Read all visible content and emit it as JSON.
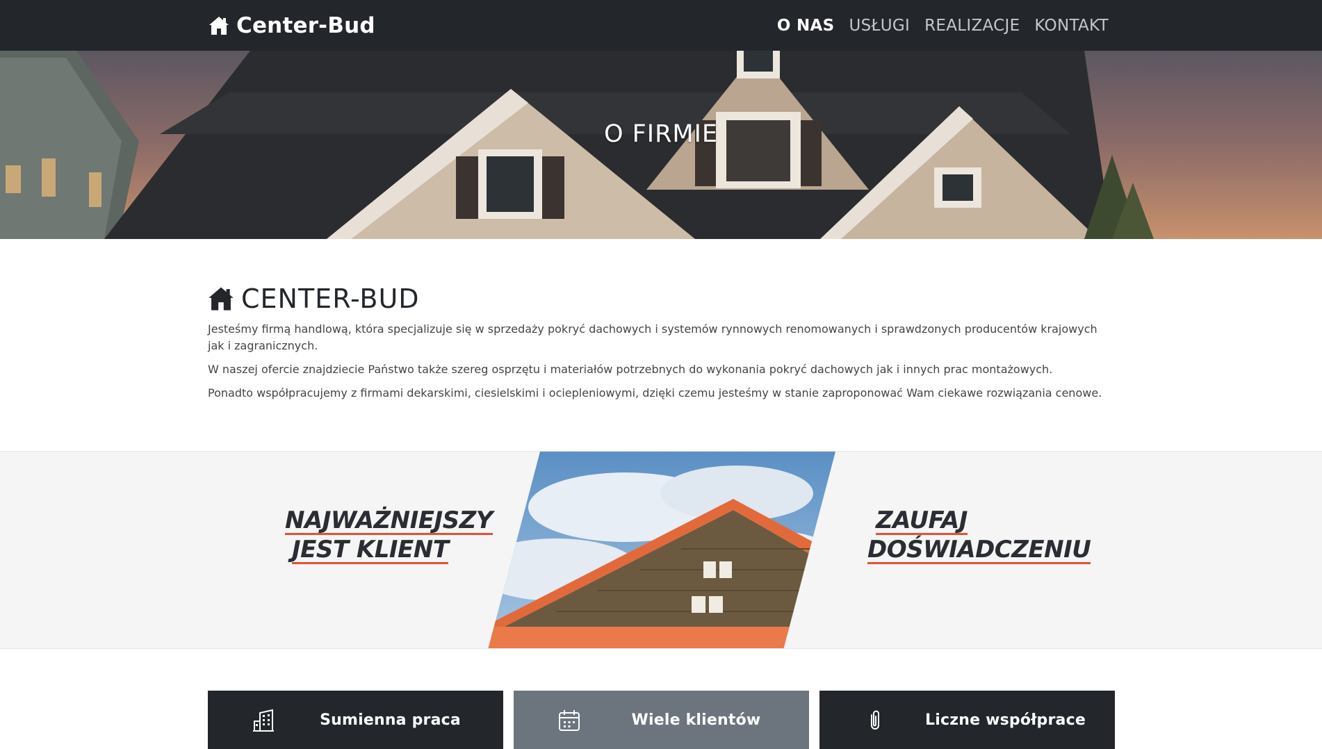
{
  "header": {
    "brand": "Center-Bud",
    "brand_icon": "home-icon",
    "nav": [
      {
        "label": "O NAS",
        "active": true
      },
      {
        "label": "USŁUGI",
        "active": false
      },
      {
        "label": "REALIZACJE",
        "active": false
      },
      {
        "label": "KONTAKT",
        "active": false
      }
    ]
  },
  "hero": {
    "title": "O FIRMIE"
  },
  "about": {
    "heading": "CENTER-BUD",
    "heading_icon": "home-icon",
    "paragraphs": [
      "Jesteśmy firmą handlową, która specjalizuje się w sprzedaży pokryć dachowych i systemów rynnowych renomowanych i sprawdzonych producentów krajowych jak i zagranicznych.",
      "W naszej ofercie znajdziecie Państwo także szereg osprzętu i materiałów potrzebnych do wykonania pokryć dachowych jak i innych prac montażowych.",
      "Ponadto współpracujemy z firmami dekarskimi, ciesielskimi i ociepleniowymi, dzięki czemu jesteśmy w stanie zaproponować Wam ciekawe rozwiązania cenowe."
    ]
  },
  "banner": {
    "left_slogan": [
      "NAJWAŻNIEJSZY",
      "JEST KLIENT"
    ],
    "right_slogan": [
      "ZAUFAJ",
      "DOŚWIADCZENIU"
    ]
  },
  "features": [
    {
      "label": "Sumienna praca",
      "icon": "building-icon"
    },
    {
      "label": "Wiele klientów",
      "icon": "calendar-icon"
    },
    {
      "label": "Liczne współprace",
      "icon": "paperclip-icon"
    }
  ],
  "colors": {
    "navbar_bg": "#23262b",
    "accent_underline": "#e05038",
    "feature_dark": "#23262b",
    "feature_alt": "#6c757d",
    "banner_bg": "#f5f5f5"
  }
}
